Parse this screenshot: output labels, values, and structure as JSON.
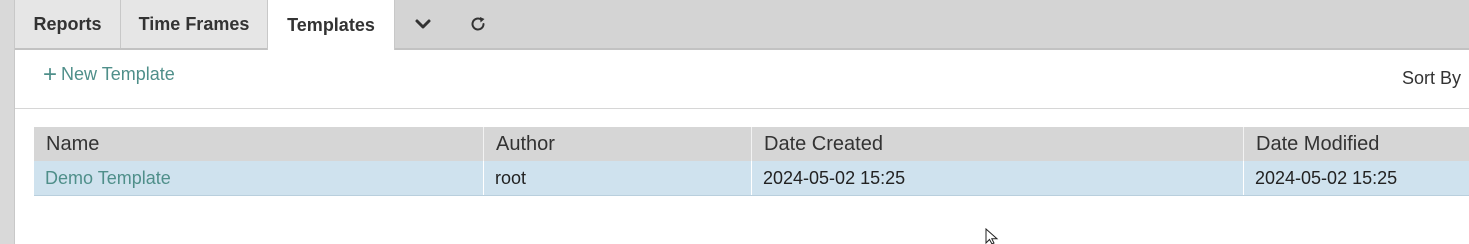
{
  "tabs": [
    {
      "label": "Reports",
      "active": false
    },
    {
      "label": "Time Frames",
      "active": false
    },
    {
      "label": "Templates",
      "active": true
    }
  ],
  "tab_icons": {
    "more": "chevron-down-icon",
    "refresh": "refresh-icon"
  },
  "toolbar": {
    "new_template_icon": "plus-icon",
    "new_template_label": "New Template",
    "sort_by_label": "Sort By"
  },
  "table": {
    "columns": [
      "Name",
      "Author",
      "Date Created",
      "Date Modified"
    ],
    "rows": [
      {
        "name": "Demo Template",
        "author": "root",
        "date_created": "2024-05-02 15:25",
        "date_modified": "2024-05-02 15:25"
      }
    ]
  },
  "colors": {
    "link": "#4f8f8a",
    "selected_row": "#cfe2ee",
    "header_bg": "#d6d6d6",
    "tabbar_bg": "#d4d4d4"
  }
}
